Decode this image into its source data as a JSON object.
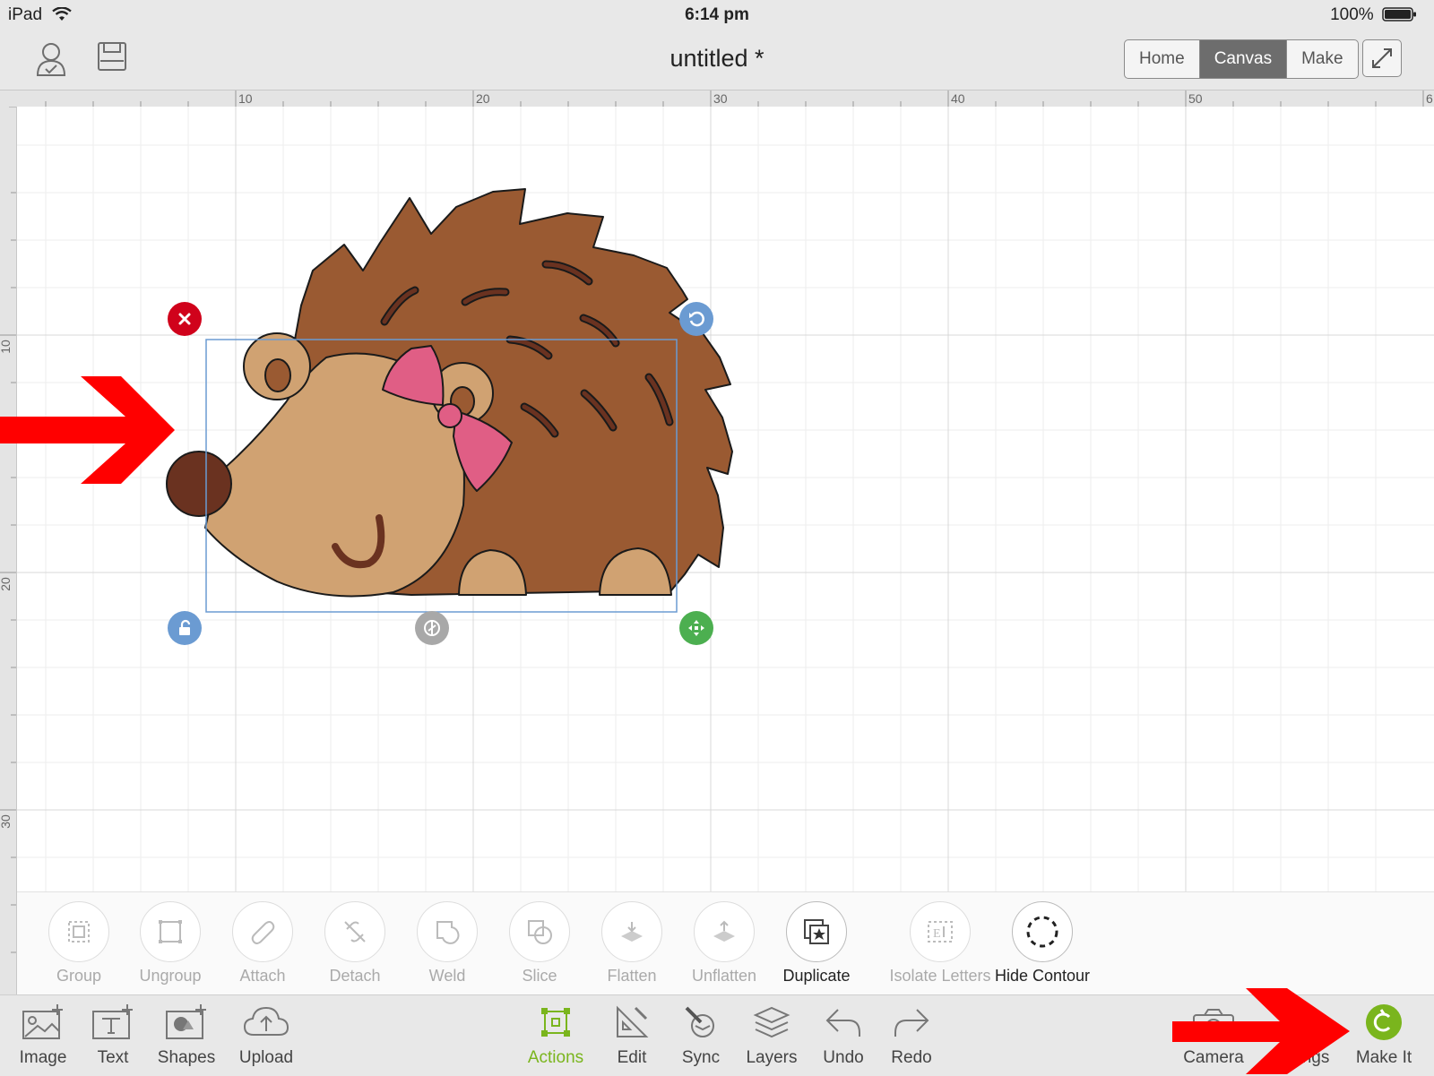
{
  "status_bar": {
    "device": "iPad",
    "time": "6:14 pm",
    "battery": "100%"
  },
  "header": {
    "title": "untitled *",
    "tabs": [
      {
        "label": "Home",
        "active": false
      },
      {
        "label": "Canvas",
        "active": true
      },
      {
        "label": "Make",
        "active": false
      }
    ],
    "icons": [
      "account-icon",
      "save-icon",
      "fullscreen-icon"
    ]
  },
  "rulers": {
    "horizontal": [
      "10",
      "20",
      "30",
      "40",
      "50",
      "6"
    ],
    "vertical": [
      "10",
      "20",
      "30"
    ]
  },
  "canvas": {
    "object": "hedgehog-with-pink-bow",
    "handles": [
      "delete-handle",
      "rotate-handle",
      "lock-handle",
      "flip-handle",
      "resize-handle"
    ]
  },
  "actions": [
    {
      "label": "Group",
      "enabled": false
    },
    {
      "label": "Ungroup",
      "enabled": false
    },
    {
      "label": "Attach",
      "enabled": false
    },
    {
      "label": "Detach",
      "enabled": false
    },
    {
      "label": "Weld",
      "enabled": false
    },
    {
      "label": "Slice",
      "enabled": false
    },
    {
      "label": "Flatten",
      "enabled": false
    },
    {
      "label": "Unflatten",
      "enabled": false
    },
    {
      "label": "Duplicate",
      "enabled": true
    },
    {
      "label": "Isolate Letters",
      "enabled": false
    },
    {
      "label": "Hide Contour",
      "enabled": true
    }
  ],
  "toolbar": {
    "left": [
      {
        "label": "Image",
        "icon": "image-add-icon"
      },
      {
        "label": "Text",
        "icon": "text-add-icon"
      },
      {
        "label": "Shapes",
        "icon": "shapes-add-icon"
      },
      {
        "label": "Upload",
        "icon": "upload-cloud-icon"
      }
    ],
    "center": [
      {
        "label": "Actions",
        "icon": "actions-icon",
        "active": true
      },
      {
        "label": "Edit",
        "icon": "edit-ruler-icon"
      },
      {
        "label": "Sync",
        "icon": "sync-icon"
      },
      {
        "label": "Layers",
        "icon": "layers-icon"
      },
      {
        "label": "Undo",
        "icon": "undo-icon"
      },
      {
        "label": "Redo",
        "icon": "redo-icon"
      }
    ],
    "right": [
      {
        "label": "Camera",
        "icon": "camera-icon"
      },
      {
        "label": "Settings",
        "icon": "settings-icon"
      },
      {
        "label": "Make It",
        "icon": "make-it-icon"
      }
    ]
  },
  "colors": {
    "accent": "#7ab51d",
    "delete": "#d0021b",
    "handle_blue": "#6b9bd2",
    "arrow": "#ff0000"
  }
}
